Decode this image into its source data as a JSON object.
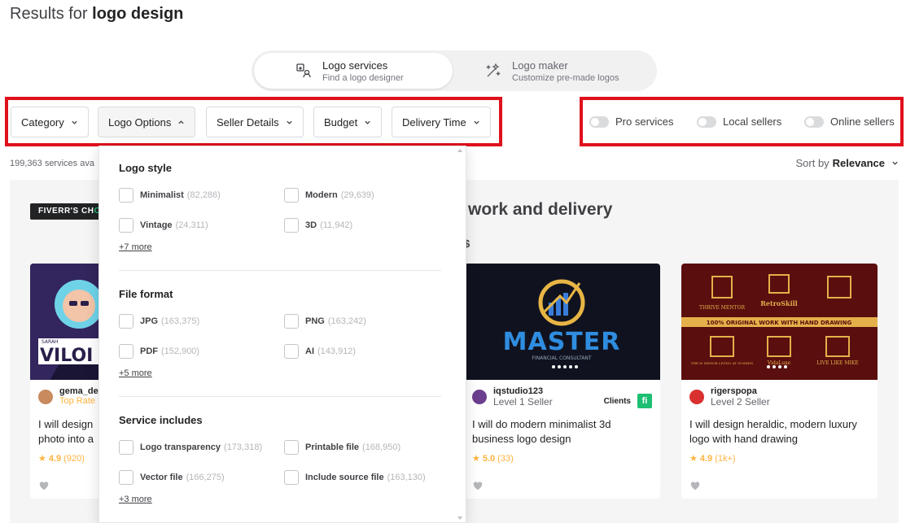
{
  "header": {
    "prefix": "Results for",
    "query": "logo design"
  },
  "switcher": [
    {
      "title": "Logo services",
      "subtitle": "Find a logo designer",
      "icon": "logo-services-icon"
    },
    {
      "title": "Logo maker",
      "subtitle": "Customize pre-made logos",
      "icon": "magic-wand-icon"
    }
  ],
  "filters": [
    {
      "label": "Category",
      "state": "closed"
    },
    {
      "label": "Logo Options",
      "state": "open"
    },
    {
      "label": "Seller Details",
      "state": "closed"
    },
    {
      "label": "Budget",
      "state": "closed"
    },
    {
      "label": "Delivery Time",
      "state": "closed"
    }
  ],
  "toggles": [
    {
      "label": "Pro services",
      "on": false
    },
    {
      "label": "Local sellers",
      "on": false
    },
    {
      "label": "Online sellers",
      "on": false
    }
  ],
  "results": {
    "count_text": "199,363 services ava"
  },
  "sort": {
    "prefix": "Sort by",
    "value": "Relevance"
  },
  "promo": {
    "badge_prefix": "FIVERR'S CH",
    "badge_accent": "O",
    "title": "work and delivery",
    "subtitle": "$"
  },
  "dropdown": {
    "sections": [
      {
        "title": "Logo style",
        "options": [
          {
            "label": "Minimalist",
            "count": "(82,286)"
          },
          {
            "label": "Modern",
            "count": "(29,639)"
          },
          {
            "label": "Vintage",
            "count": "(24,311)"
          },
          {
            "label": "3D",
            "count": "(11,942)"
          }
        ],
        "more": "+7 more"
      },
      {
        "title": "File format",
        "options": [
          {
            "label": "JPG",
            "count": "(163,375)"
          },
          {
            "label": "PNG",
            "count": "(163,242)"
          },
          {
            "label": "PDF",
            "count": "(152,900)"
          },
          {
            "label": "AI",
            "count": "(143,912)"
          }
        ],
        "more": "+5 more"
      },
      {
        "title": "Service includes",
        "options": [
          {
            "label": "Logo transparency",
            "count": "(173,318)"
          },
          {
            "label": "Printable file",
            "count": "(168,950)"
          },
          {
            "label": "Vector file",
            "count": "(166,275)"
          },
          {
            "label": "Include source file",
            "count": "(163,130)"
          }
        ],
        "more": "+3 more"
      }
    ]
  },
  "gigs": [
    {
      "seller": "gema_de",
      "level": "Top Rate",
      "title": "I will design ... photo into a",
      "title_line1": "I will design",
      "title_line2": "photo into a",
      "rating": "4.9",
      "reviews": "(920)",
      "clients": "",
      "image_text": "SARAH VILOI"
    },
    {
      "seller": "iqstudio123",
      "level": "Level 1 Seller",
      "title": "I will do modern minimalist 3d business logo design",
      "rating": "5.0",
      "reviews": "(33)",
      "clients": "Clients",
      "clients_badge": "fi",
      "image_text": "MASTER",
      "image_subtext": "FINANCIAL CONSULTANT"
    },
    {
      "seller": "rigerspopa",
      "level": "Level 2 Seller",
      "title": "I will design heraldic, modern luxury logo with hand drawing",
      "rating": "4.9",
      "reviews": "(1k+)",
      "clients": "",
      "image_banner": "100% ORIGINAL WORK WITH HAND DRAWING",
      "image_labels": [
        "THRIVE MENTOR",
        "RetroSkill",
        "THE W SENIOR LIVING AT GOSHEN",
        "VidaLuxe",
        "LIVE LIKE MIKE"
      ]
    }
  ],
  "colors": {
    "highlight": "#e0101c",
    "accent_green": "#1dbf73",
    "star": "#ffb33e"
  }
}
